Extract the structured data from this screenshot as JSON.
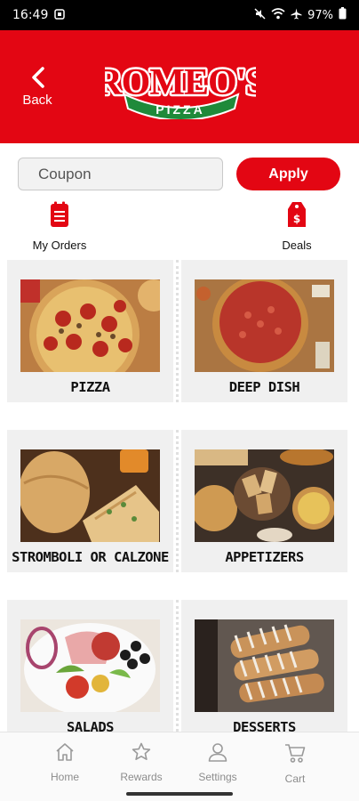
{
  "status_bar": {
    "time": "16:49",
    "battery": "97%"
  },
  "header": {
    "back_label": "Back",
    "logo_main": "ROMEO'S",
    "logo_sub": "PIZZA",
    "brand_color": "#e30613"
  },
  "coupon": {
    "placeholder": "Coupon",
    "apply_label": "Apply"
  },
  "quick_actions": {
    "orders_label": "My Orders",
    "deals_label": "Deals"
  },
  "categories": [
    {
      "label": "PIZZA"
    },
    {
      "label": "DEEP DISH"
    },
    {
      "label": "STROMBOLI OR CALZONE"
    },
    {
      "label": "APPETIZERS"
    },
    {
      "label": "SALADS"
    },
    {
      "label": "DESSERTS"
    }
  ],
  "bottom_nav": {
    "home": "Home",
    "rewards": "Rewards",
    "settings": "Settings",
    "cart": "Cart"
  }
}
